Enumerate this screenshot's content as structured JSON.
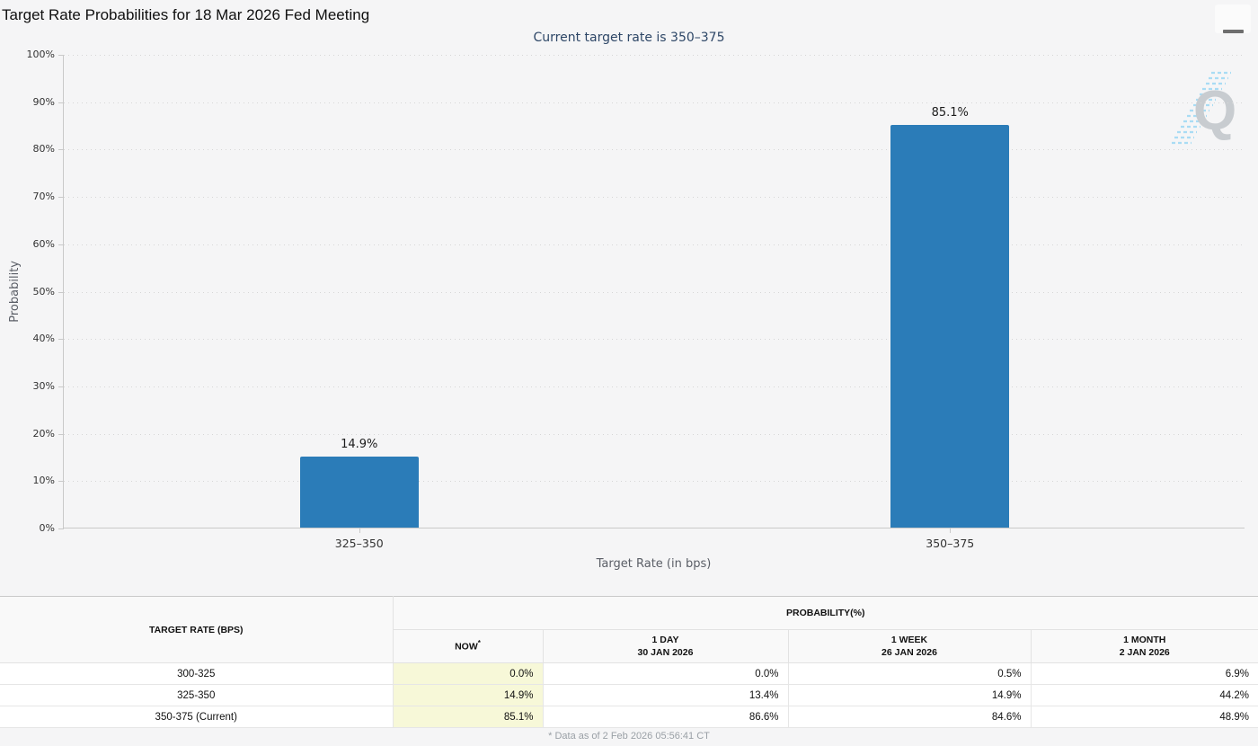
{
  "header": {
    "title": "Target Rate Probabilities for 18 Mar 2026 Fed Meeting",
    "subtitle": "Current target rate is 350–375"
  },
  "chart_data": {
    "type": "bar",
    "title": "Current target rate is 350–375",
    "categories": [
      "325–350",
      "350–375"
    ],
    "values": [
      14.9,
      85.1
    ],
    "bar_labels": [
      "14.9%",
      "85.1%"
    ],
    "xlabel": "Target Rate (in bps)",
    "ylabel": "Probability",
    "ylim": [
      0,
      100
    ],
    "y_ticks": [
      "0%",
      "10%",
      "20%",
      "30%",
      "40%",
      "50%",
      "60%",
      "70%",
      "80%",
      "90%",
      "100%"
    ],
    "grid": "dotted horizontal",
    "legend": "none",
    "bar_color": "#2b7cb8"
  },
  "table": {
    "row_header": "TARGET RATE (BPS)",
    "group_header": "PROBABILITY(%)",
    "columns": [
      {
        "label": "NOW",
        "sup": "*",
        "sub": ""
      },
      {
        "label": "1 DAY",
        "sub": "30 JAN 2026"
      },
      {
        "label": "1 WEEK",
        "sub": "26 JAN 2026"
      },
      {
        "label": "1 MONTH",
        "sub": "2 JAN 2026"
      }
    ],
    "rows": [
      {
        "label": "300-325",
        "values": [
          "0.0%",
          "0.0%",
          "0.5%",
          "6.9%"
        ]
      },
      {
        "label": "325-350",
        "values": [
          "14.9%",
          "13.4%",
          "14.9%",
          "44.2%"
        ]
      },
      {
        "label": "350-375 (Current)",
        "values": [
          "85.1%",
          "86.6%",
          "84.6%",
          "48.9%"
        ]
      }
    ],
    "now_highlight_color": "#f7f8d8"
  },
  "footer": {
    "note": "* Data as of 2 Feb 2026 05:56:41 CT"
  }
}
